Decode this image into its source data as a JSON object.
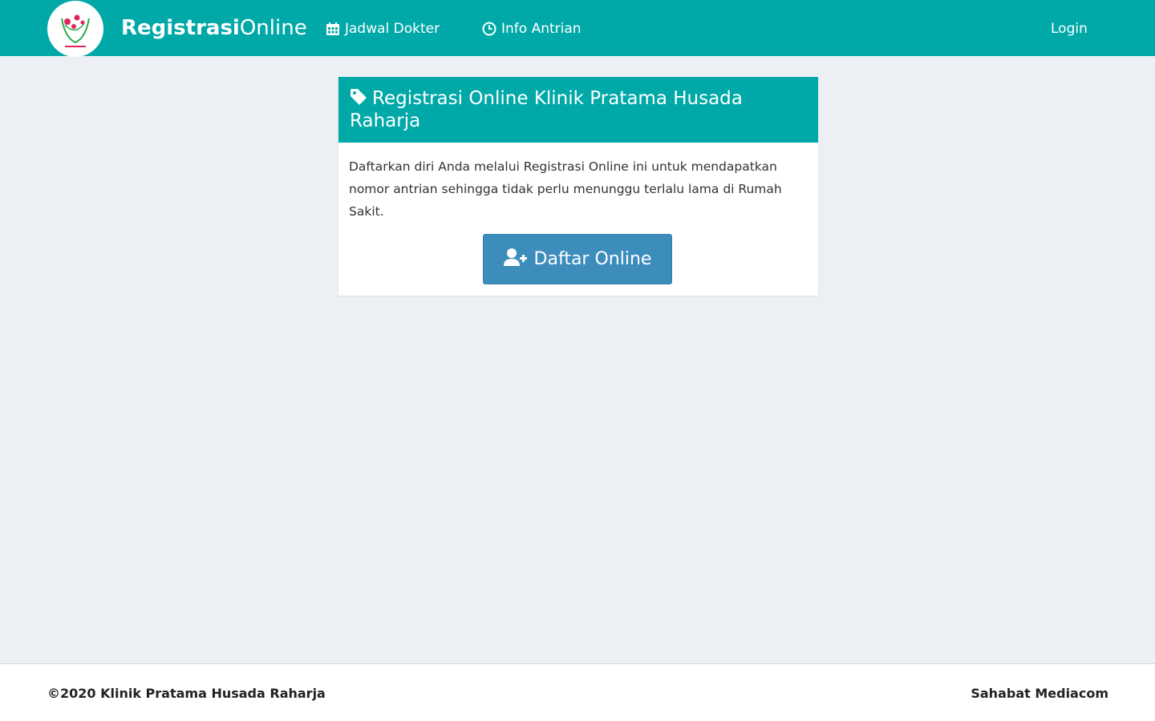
{
  "header": {
    "brand_bold": "Registrasi",
    "brand_light": "Online",
    "nav": {
      "jadwal_label": "Jadwal Dokter",
      "info_label": "Info Antrian",
      "login_label": "Login"
    },
    "icons": {
      "jadwal": "calendar-icon",
      "info": "clock-icon"
    }
  },
  "card": {
    "title": "Registrasi Online Klinik Pratama Husada Raharja",
    "title_icon": "tag-icon",
    "description": "Daftarkan diri Anda melalui Registrasi Online ini untuk mendapatkan nomor antrian sehingga tidak perlu menunggu terlalu lama di Rumah Sakit.",
    "button_label": "Daftar Online",
    "button_icon": "user-plus-icon"
  },
  "footer": {
    "copyright": "©2020 Klinik Pratama Husada Raharja",
    "credit": "Sahabat Mediacom"
  },
  "colors": {
    "primary": "#00a8a8",
    "button": "#3c8dbc",
    "background": "#ecf0f5"
  }
}
